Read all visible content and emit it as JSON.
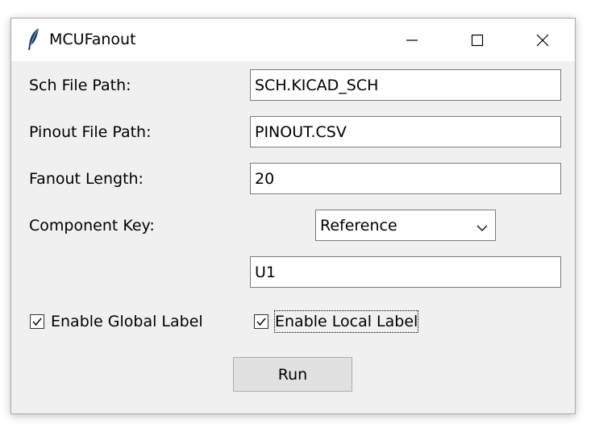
{
  "window": {
    "title": "MCUFanout"
  },
  "form": {
    "sch_path_label": "Sch File Path:",
    "sch_path_value": "SCH.KICAD_SCH",
    "pinout_path_label": "Pinout File Path:",
    "pinout_path_value": "PINOUT.CSV",
    "fanout_length_label": "Fanout Length:",
    "fanout_length_value": "20",
    "component_key_label": "Component Key:",
    "component_key_selected": "Reference",
    "component_key_value": "U1",
    "enable_global_label": "Enable Global Label",
    "enable_global_checked": true,
    "enable_local_label": "Enable Local Label",
    "enable_local_checked": true,
    "run_label": "Run"
  },
  "icons": {
    "app": "feather-icon",
    "minimize": "minimize-icon",
    "maximize": "maximize-icon",
    "close": "close-icon",
    "dropdown": "chevron-down-icon",
    "check": "checkmark-icon"
  }
}
